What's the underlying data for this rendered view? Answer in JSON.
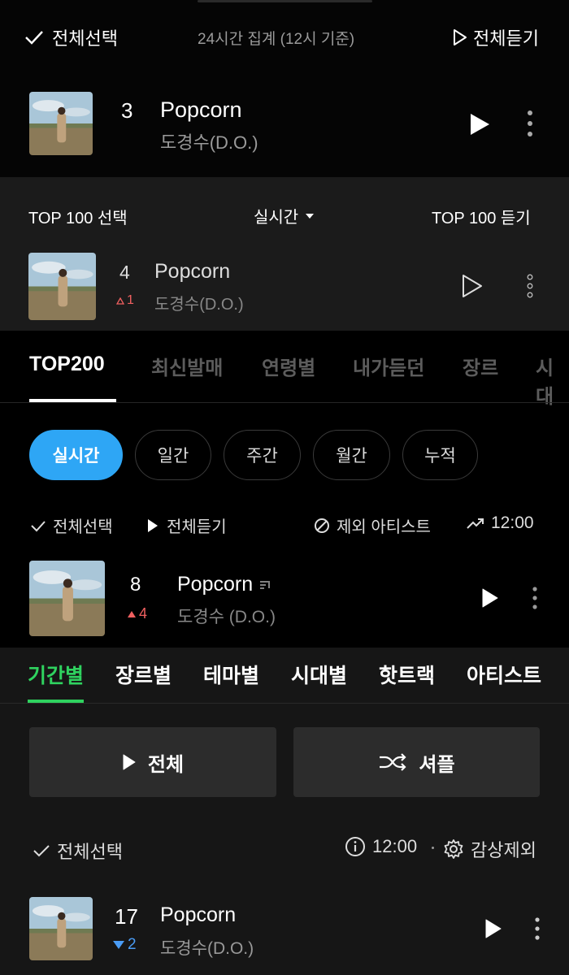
{
  "section1": {
    "select_all": "전체선택",
    "aggregate": "24시간 집계 (12시 기준)",
    "play_all": "전체듣기",
    "rank": "3",
    "title": "Popcorn",
    "artist": "도경수(D.O.)"
  },
  "section2": {
    "top100_select": "TOP 100 선택",
    "mode": "실시간",
    "top100_play": "TOP 100 듣기",
    "rank": "4",
    "change": "1",
    "title": "Popcorn",
    "artist": "도경수(D.O.)"
  },
  "section3": {
    "tabs": [
      "TOP200",
      "최신발매",
      "연령별",
      "내가듣던",
      "장르",
      "시대"
    ],
    "pills": [
      "실시간",
      "일간",
      "주간",
      "월간",
      "누적"
    ],
    "select_all": "전체선택",
    "play_all": "전체듣기",
    "exclude_artist": "제외 아티스트",
    "time": "12:00",
    "rank": "8",
    "change": "4",
    "title": "Popcorn",
    "artist": "도경수 (D.O.)"
  },
  "section4": {
    "tabs": [
      "기간별",
      "장르별",
      "테마별",
      "시대별",
      "핫트랙",
      "아티스트"
    ],
    "play_all": "전체",
    "shuffle": "셔플",
    "select_all": "전체선택",
    "time": "12:00",
    "exclude": "감상제외",
    "rank": "17",
    "change": "2",
    "title": "Popcorn",
    "artist": "도경수(D.O.)"
  },
  "colors": {
    "accent_blue": "#2ea6f5",
    "accent_green": "#2fd25f",
    "up_red": "#f06060",
    "down_blue": "#4a9cf5"
  }
}
